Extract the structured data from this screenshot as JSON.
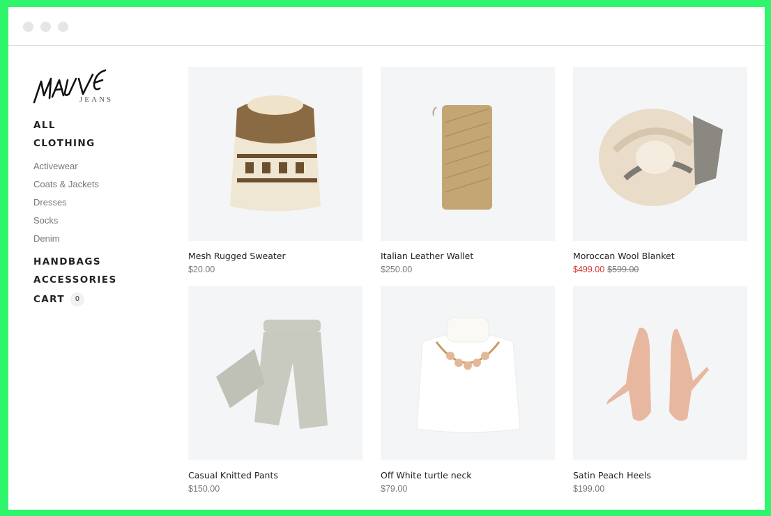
{
  "brand": {
    "logo_text": "MAUVE",
    "sub_text": "JEANS"
  },
  "nav": {
    "all": "ALL",
    "clothing": "CLOTHING",
    "sub_items": [
      "Activewear",
      "Coats & Jackets",
      "Dresses",
      "Socks",
      "Denim"
    ],
    "handbags": "HANDBAGS",
    "accessories": "ACCESSORIES",
    "cart": "CART",
    "cart_count": "0"
  },
  "products": [
    {
      "name": "Mesh Rugged Sweater",
      "price": "$20.00"
    },
    {
      "name": "Italian Leather Wallet",
      "price": "$250.00"
    },
    {
      "name": "Moroccan Wool Blanket",
      "sale_price": "$499.00",
      "original_price": "$599.00"
    },
    {
      "name": "Casual Knitted Pants",
      "price": "$150.00"
    },
    {
      "name": "Off White turtle neck",
      "price": "$79.00"
    },
    {
      "name": "Satin Peach Heels",
      "price": "$199.00"
    }
  ],
  "colors": {
    "accent_sale": "#d43a33",
    "frame": "#2ef56b",
    "tile_bg": "#f4f5f7"
  }
}
